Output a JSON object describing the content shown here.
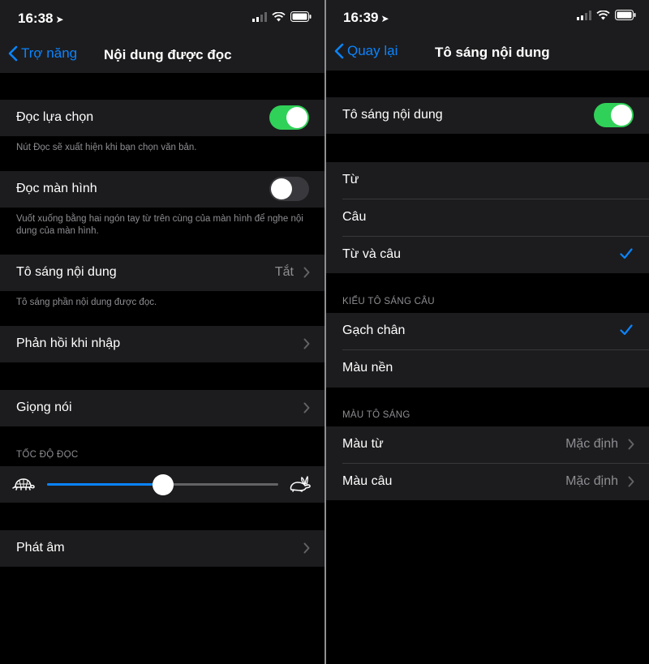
{
  "colors": {
    "accent": "#0a84ff",
    "toggle_on": "#30d158",
    "cell_bg": "#1c1c1e",
    "secondary_text": "#8e8e93"
  },
  "left": {
    "status": {
      "time": "16:38"
    },
    "nav": {
      "back_label": "Trợ năng",
      "title": "Nội dung được đọc"
    },
    "speak_selection": {
      "label": "Đọc lựa chọn",
      "on": true,
      "footer": "Nút Đọc sẽ xuất hiện khi bạn chọn văn bản."
    },
    "speak_screen": {
      "label": "Đọc màn hình",
      "on": false,
      "footer": "Vuốt xuống bằng hai ngón tay từ trên cùng của màn hình để nghe nội dung của màn hình."
    },
    "highlight_content": {
      "label": "Tô sáng nội dung",
      "value": "Tắt",
      "footer": "Tô sáng phần nội dung được đọc."
    },
    "typing_feedback": {
      "label": "Phản hồi khi nhập"
    },
    "voices": {
      "label": "Giọng nói"
    },
    "speaking_rate": {
      "header": "TỐC ĐỘ ĐỌC",
      "level": 0.5
    },
    "pronunciations": {
      "label": "Phát âm"
    }
  },
  "right": {
    "status": {
      "time": "16:39"
    },
    "nav": {
      "back_label": "Quay lại",
      "title": "Tô sáng nội dung"
    },
    "highlight_content": {
      "label": "Tô sáng nội dung",
      "on": true
    },
    "options": [
      {
        "label": "Từ",
        "checked": false
      },
      {
        "label": "Câu",
        "checked": false
      },
      {
        "label": "Từ và câu",
        "checked": true
      }
    ],
    "sentence_style": {
      "header": "KIỂU TÔ SÁNG CÂU",
      "options": [
        {
          "label": "Gạch chân",
          "checked": true
        },
        {
          "label": "Màu nền",
          "checked": false
        }
      ]
    },
    "highlight_color": {
      "header": "MÀU TÔ SÁNG",
      "word_color": {
        "label": "Màu từ",
        "value": "Mặc định"
      },
      "sentence_color": {
        "label": "Màu câu",
        "value": "Mặc định"
      }
    }
  }
}
